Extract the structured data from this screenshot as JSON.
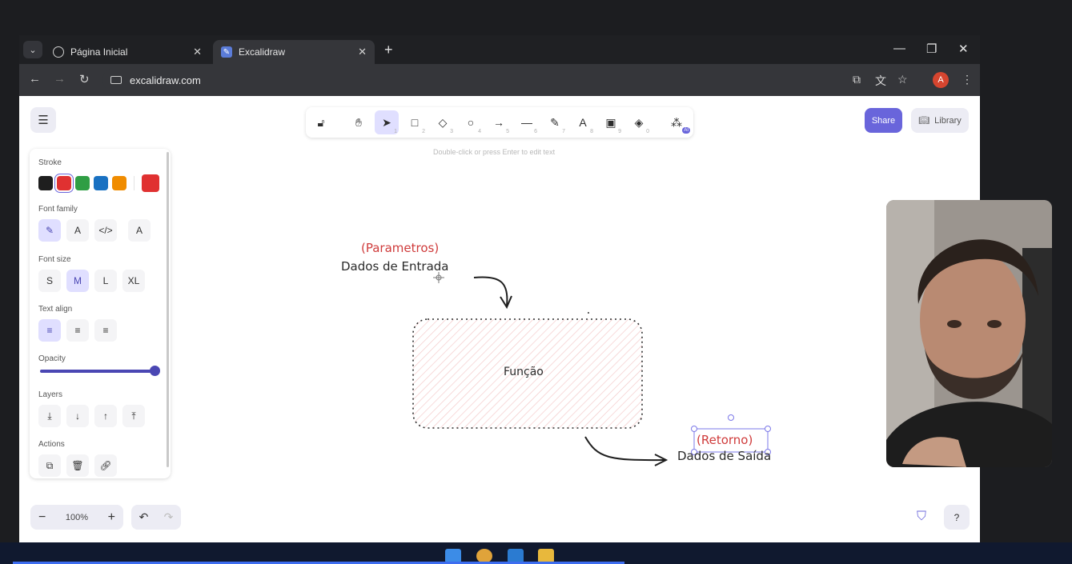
{
  "browser": {
    "tabs": [
      {
        "label": "Página Inicial",
        "active": false
      },
      {
        "label": "Excalidraw",
        "active": true
      }
    ],
    "url": "excalidraw.com",
    "profile_initial": "A"
  },
  "app": {
    "hint": "Double-click or press Enter to edit text",
    "share_label": "Share",
    "library_label": "Library",
    "tools": [
      {
        "name": "lock",
        "key": ""
      },
      {
        "name": "hand",
        "key": ""
      },
      {
        "name": "selection",
        "key": "1",
        "selected": true
      },
      {
        "name": "rectangle",
        "key": "2"
      },
      {
        "name": "diamond",
        "key": "3"
      },
      {
        "name": "ellipse",
        "key": "4"
      },
      {
        "name": "arrow",
        "key": "5"
      },
      {
        "name": "line",
        "key": "6"
      },
      {
        "name": "draw",
        "key": "7"
      },
      {
        "name": "text",
        "key": "8"
      },
      {
        "name": "image",
        "key": "9"
      },
      {
        "name": "eraser",
        "key": "0"
      },
      {
        "name": "extra-tools",
        "badge": "AI"
      }
    ]
  },
  "panel": {
    "stroke_label": "Stroke",
    "stroke_colors": [
      "#1e1e1e",
      "#e03131",
      "#2f9e44",
      "#1971c2",
      "#f08c00"
    ],
    "stroke_selected": "#e03131",
    "font_family_label": "Font family",
    "font_family_options": [
      "hand-drawn",
      "A",
      "</>",
      "A"
    ],
    "font_size_label": "Font size",
    "font_sizes": [
      "S",
      "M",
      "L",
      "XL"
    ],
    "font_size_selected": "M",
    "text_align_label": "Text align",
    "opacity_label": "Opacity",
    "opacity": 100,
    "layers_label": "Layers",
    "actions_label": "Actions"
  },
  "canvas": {
    "param_label": "(Parametros)",
    "input_label": "Dados de Entrada",
    "function_label": "Função",
    "return_label": "(Retorno)",
    "output_label": "Dados de Saída"
  },
  "footer": {
    "zoom": "100%"
  }
}
